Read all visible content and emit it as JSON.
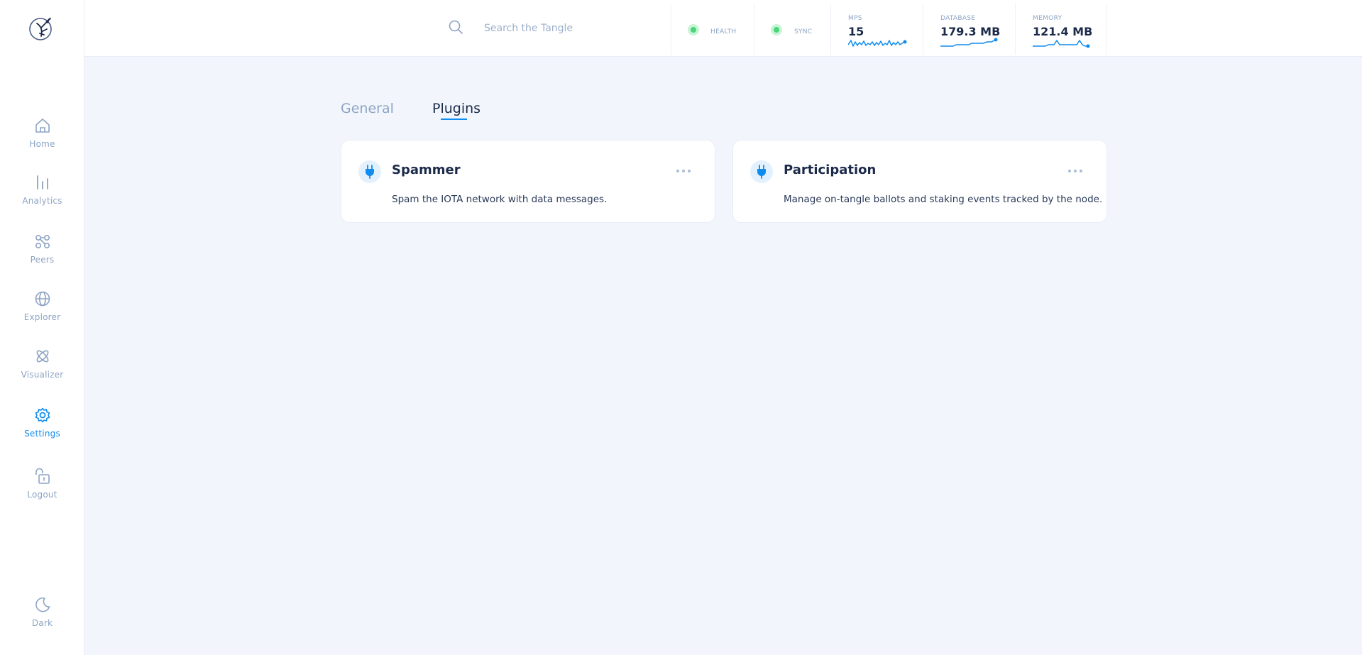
{
  "sidebar": {
    "items": [
      {
        "label": "Home",
        "icon": "home-icon",
        "active": false
      },
      {
        "label": "Analytics",
        "icon": "analytics-icon",
        "active": false
      },
      {
        "label": "Peers",
        "icon": "peers-icon",
        "active": false
      },
      {
        "label": "Explorer",
        "icon": "globe-icon",
        "active": false
      },
      {
        "label": "Visualizer",
        "icon": "visualizer-icon",
        "active": false
      },
      {
        "label": "Settings",
        "icon": "gear-icon",
        "active": true
      },
      {
        "label": "Logout",
        "icon": "unlock-icon",
        "active": false
      }
    ],
    "theme_toggle": {
      "label": "Dark",
      "icon": "moon-icon"
    }
  },
  "header": {
    "search": {
      "placeholder": "Search the Tangle",
      "value": ""
    },
    "health": {
      "label": "HEALTH",
      "status_color": "#4ad678"
    },
    "sync": {
      "label": "SYNC",
      "status_color": "#4ad678"
    },
    "mps": {
      "label": "MPS",
      "value": "15"
    },
    "database": {
      "label": "DATABASE",
      "value": "179.3 MB"
    },
    "memory": {
      "label": "MEMORY",
      "value": "121.4 MB"
    }
  },
  "tabs": [
    {
      "label": "General",
      "active": false
    },
    {
      "label": "Plugins",
      "active": true
    }
  ],
  "plugins": [
    {
      "title": "Spammer",
      "description": "Spam the IOTA network with data messages.",
      "icon": "plug-icon"
    },
    {
      "title": "Participation",
      "description": "Manage on-tangle ballots and staking events tracked by the node.",
      "icon": "plug-icon"
    }
  ],
  "colors": {
    "accent": "#108cee",
    "text": "#1c2b4a",
    "muted": "#8da4c4",
    "background": "#f2f6fc",
    "status_ok": "#4ad678"
  }
}
